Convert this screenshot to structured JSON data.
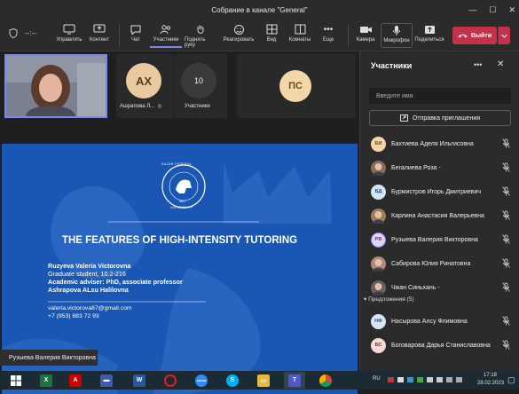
{
  "window": {
    "title": "Собрание в канале \"General\"",
    "controls": [
      "—",
      "☐",
      "✕"
    ]
  },
  "toolbar": {
    "timer": "--:--",
    "buttons": [
      {
        "label": "Управлять",
        "icon": "manage-icon"
      },
      {
        "label": "Контент",
        "icon": "share-content-icon"
      },
      {
        "label": "Чат",
        "icon": "chat-icon"
      },
      {
        "label": "Участники",
        "icon": "people-icon",
        "active": true
      },
      {
        "label": "Поднять руку",
        "icon": "raise-hand-icon"
      },
      {
        "label": "Реагировать",
        "icon": "react-icon"
      },
      {
        "label": "Вид",
        "icon": "view-icon"
      },
      {
        "label": "Комнаты",
        "icon": "rooms-icon"
      },
      {
        "label": "Еще",
        "icon": "more-icon"
      },
      {
        "label": "Камера",
        "icon": "camera-icon"
      },
      {
        "label": "Микрофон",
        "icon": "microphone-icon"
      },
      {
        "label": "Поделиться",
        "icon": "share-icon"
      }
    ],
    "leave_label": "Выйти"
  },
  "stage": {
    "tiles": [
      {
        "initials": "АХ",
        "name": "Ашрапова Л...",
        "color": "#e8c9a0",
        "text_color": "#5a3c1a"
      },
      {
        "count": "10",
        "name": "Участники"
      },
      {
        "initials": "ПС",
        "color": "#f2d7a8",
        "text_color": "#6b4a1a"
      }
    ],
    "slide": {
      "university_lines": [
        "KAZAN FEDERAL",
        "UNIVERSITY",
        "1804"
      ],
      "title": "THE FEATURES OF HIGH-INTENSITY TUTORING",
      "lines": [
        {
          "text": "Ruzyeva Valeria Victorovna",
          "bold": true
        },
        {
          "text": "Graduate student, 10.2-216",
          "bold": false
        },
        {
          "text": "Academic adviser: PhD, associate professor",
          "bold": true
        },
        {
          "text": "Ashrapova ALsu Halilovna",
          "bold": true
        },
        {
          "text": "valeria.victorova87@gmail.com",
          "bold": false
        },
        {
          "text": "+7 (953) 883 72 93",
          "bold": false
        }
      ]
    },
    "presenter": "Рузыева Валерия Викторовна"
  },
  "panel": {
    "title": "Участники",
    "search_placeholder": "Введите имя",
    "invite_label": "Отправка приглашения",
    "participants": [
      {
        "initials": "БИ",
        "name": "Бахтиева Аделя Ильгисовна",
        "color": "#f2d7a8",
        "text": "#6b4a1a"
      },
      {
        "initials": "",
        "name": "Бегалиева Роза -",
        "color": "#8a6b5a",
        "text": "#fff"
      },
      {
        "initials": "БД",
        "name": "Бурмистров Игорь Дмитриевич",
        "color": "#cfe6f5",
        "text": "#1f4f73"
      },
      {
        "initials": "",
        "name": "Карлина Анастасия Валерьевна",
        "color": "#9a7f5c",
        "text": "#fff"
      },
      {
        "initials": "РВ",
        "name": "Рузыева Валерия Викторовна",
        "color": "#e3d4f2",
        "text": "#5a3a80"
      },
      {
        "initials": "",
        "name": "Сабирова Юлия Ринатовна",
        "color": "#b08a7a",
        "text": "#fff"
      },
      {
        "initials": "",
        "name": "Чжан Синьхань -",
        "color": "#6a5f63",
        "text": "#fff"
      }
    ],
    "suggestions_label": "Предложения (5)",
    "suggestions": [
      {
        "initials": "НФ",
        "name": "Насырова Алсу Флимовна",
        "color": "#d9e6f5",
        "text": "#28507a"
      },
      {
        "initials": "БС",
        "name": "Боговарова Дарья Станиславовна",
        "color": "#f5d9d9",
        "text": "#7a2828"
      }
    ]
  },
  "taskbar": {
    "lang": "RU",
    "time": "17:18",
    "date": "28.02.2023"
  }
}
